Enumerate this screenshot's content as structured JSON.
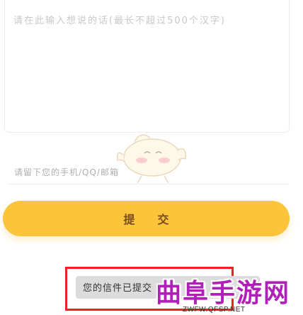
{
  "message": {
    "placeholder": "请在此输入想说的话(最长不超过500个汉字)"
  },
  "contact": {
    "placeholder": "请留下您的手机/QQ/邮箱"
  },
  "submit": {
    "label": "提交"
  },
  "toast": {
    "text": "您的信件已提交"
  },
  "watermark": {
    "title": "曲阜手游网",
    "url": "ZWFW.QFSP.NET"
  },
  "colors": {
    "accent": "#fbc43a",
    "button_text": "#7a4c18",
    "highlight_border": "#ee2222",
    "watermark": "#b01fb8"
  }
}
